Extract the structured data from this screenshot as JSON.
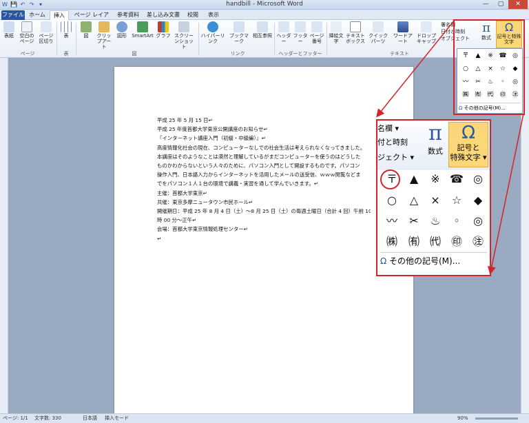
{
  "window": {
    "title": "handbill - Microsoft Word",
    "qat": [
      "W",
      "💾",
      "↶",
      "↷",
      "▾"
    ],
    "controls": [
      "—",
      "▢",
      "✕"
    ]
  },
  "tabs": [
    "ファイル",
    "ホーム",
    "挿入",
    "ページ レイアウト",
    "参考資料",
    "差し込み文書",
    "校閲",
    "表示"
  ],
  "ribbon": {
    "buttons": [
      "表紙",
      "空白のページ",
      "ページ区切り",
      "表",
      "図",
      "クリップアート",
      "図形",
      "SmartArt",
      "グラフ",
      "スクリーンショット",
      "ハイパーリンク",
      "ブックマーク",
      "相互参照",
      "ヘッダー",
      "フッター",
      "ページ番号",
      "挿絵文字",
      "テキストボックス",
      "クイック パーツ",
      "ワードアート",
      "ドロップキャップ"
    ],
    "groups": [
      "ページ",
      "表",
      "図",
      "リンク",
      "ヘッダーとフッター",
      "テキスト"
    ],
    "right_small": [
      "署名欄",
      "日付と時刻",
      "オブジェクト"
    ],
    "equation": "数式",
    "symbol": "記号と特殊文字"
  },
  "document": {
    "lines": [
      "平成 25 年 5 月 15 日↵",
      "平成 25 年度首都大学東京公開講座のお知らせ↵",
      "『インターネット講座入門（初級・中級編）』↵",
      "高度情報化社会の現在、コンピューターなしでの社会生活は考えられなくなってきました。",
      "本講座はそのようなことは漠然と理解しているがまだコンピューターを使うのはどうした",
      "ものかわからないという人々のために、パソコン入門として開設するものです。パソコン",
      "操作入門、日本語入力からインターネットを活用したメールの送受信、ｗｗｗ閲覧などま",
      "でをパソコン１人１台の環境で講義・実習を通して学んでいきます。↵",
      "主催：首都大学東京↵",
      "共催：東京多摩ニュータウン市民ホール↵",
      "開催期日：平成 25 年 8 月 4 日（土）～8 月 25 日（土）の毎週土曜日（合計 4 回）午前 10",
      "時 00 分～正午↵",
      "会場：首都大学東京情報処理センター↵",
      "↵"
    ]
  },
  "symbols": {
    "grid": [
      "〒",
      "▲",
      "※",
      "☎",
      "◎",
      "○",
      "△",
      "×",
      "☆",
      "◆",
      "〰",
      "✂",
      "♨",
      "◦",
      "◎",
      "㈱",
      "㈲",
      "㈹",
      "㊞",
      "㊟"
    ],
    "more_label": "その他の記号(M)...",
    "omega": "Ω"
  },
  "zoom_panel": {
    "top_items": [
      "名欄 ▾",
      "付と時刻",
      "ジェクト ▾"
    ],
    "equation": "数式",
    "symbol_line1": "記号と",
    "symbol_line2": "特殊文字 ▾",
    "pi": "π"
  },
  "status": {
    "page": "ページ: 1/1",
    "words": "文字数: 330",
    "lang": "日本語",
    "mode": "挿入モード",
    "zoom": "90%"
  },
  "colors": {
    "highlight": "#d2232a",
    "file_tab": "#2b579a",
    "symbol_btn": "#fbd77a"
  }
}
